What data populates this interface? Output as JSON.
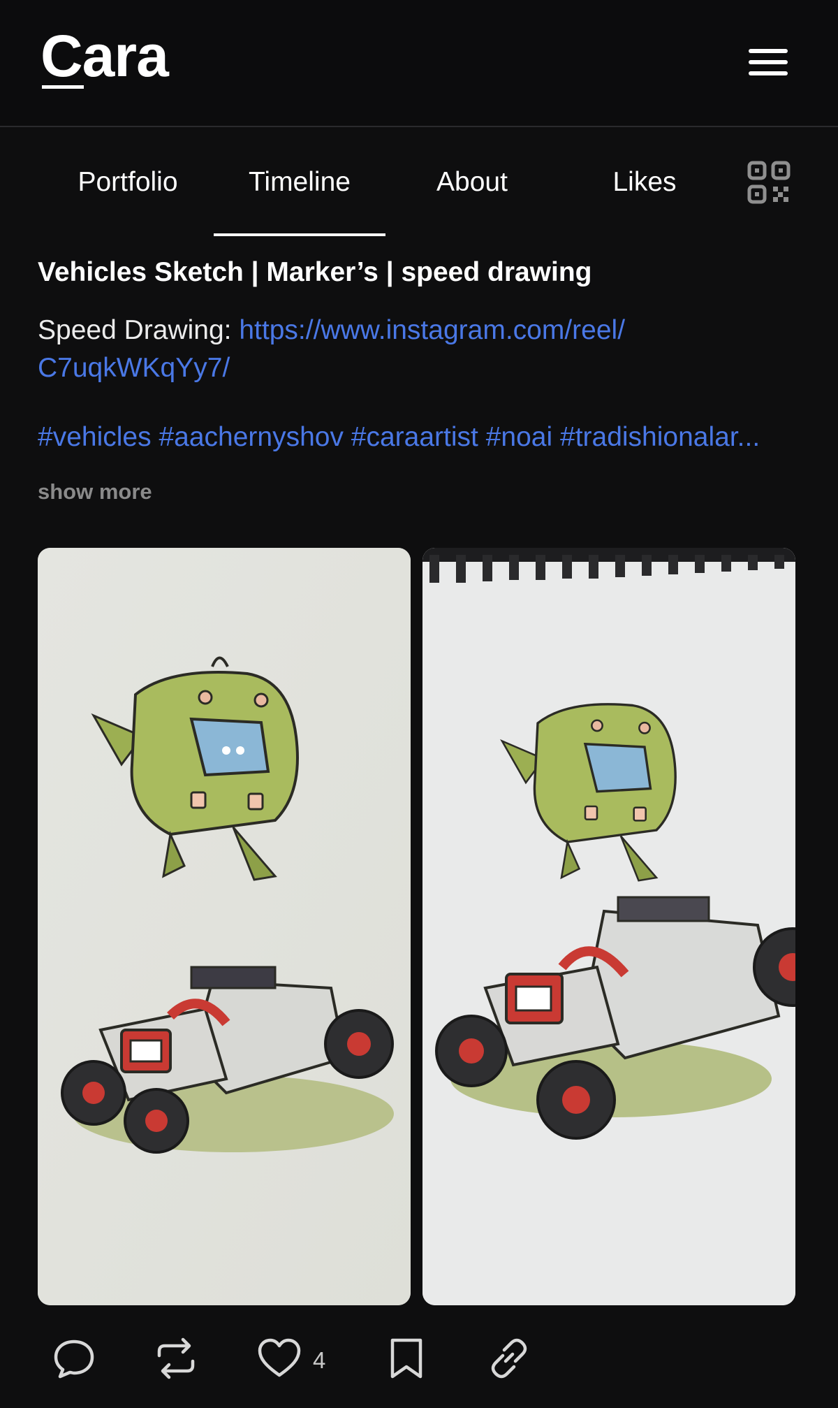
{
  "app": {
    "logo": "Cara"
  },
  "tabs": [
    {
      "label": "Portfolio",
      "active": false
    },
    {
      "label": "Timeline",
      "active": true
    },
    {
      "label": "About",
      "active": false
    },
    {
      "label": "Likes",
      "active": false
    }
  ],
  "post": {
    "title": "Vehicles Sketch | Marker’s | speed drawing",
    "description_prefix": "Speed Drawing: ",
    "link_line1": "https://www.instagram.com/reel/",
    "link_line2": "C7uqkWKqYy7/",
    "tags": [
      "#vehicles",
      "#aachernyshov",
      "#caraartist",
      "#noai",
      "#tradishionalar..."
    ],
    "show_more": "show more",
    "like_count": "4"
  },
  "colors": {
    "background": "#0e0e0f",
    "link": "#4a78e6",
    "muted": "#8a8a8a",
    "icon": "#d8d8d8"
  },
  "icons": [
    "menu-icon",
    "qr-code-icon",
    "comment-icon",
    "repost-icon",
    "heart-icon",
    "bookmark-icon",
    "link-icon"
  ]
}
